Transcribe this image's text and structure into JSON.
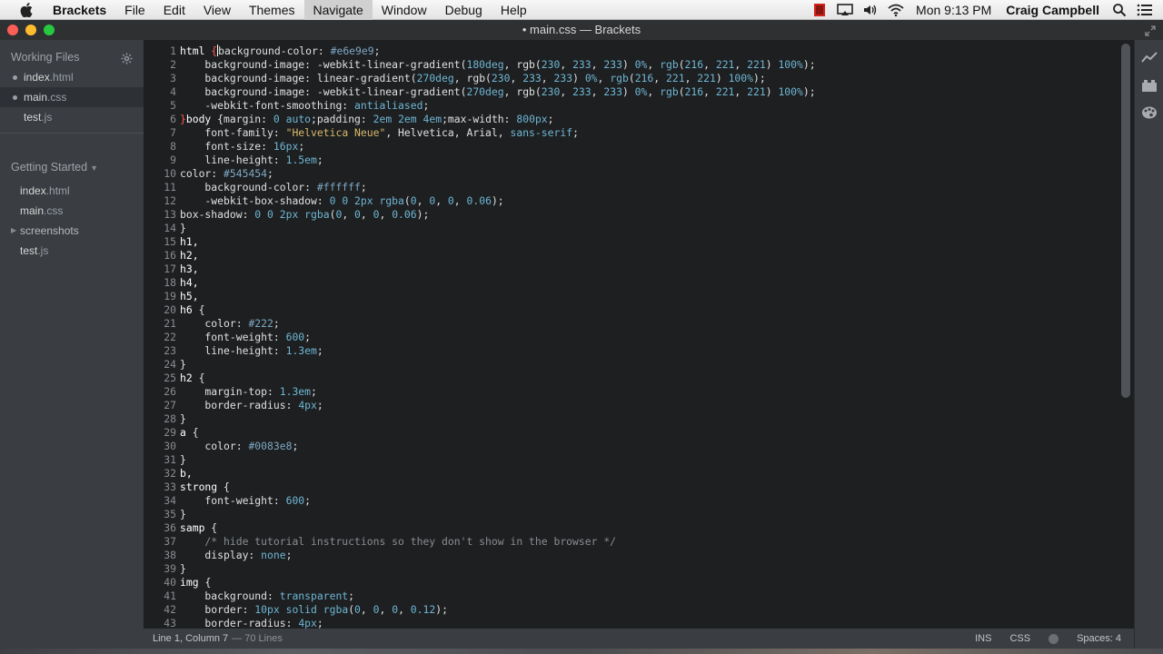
{
  "menubar": {
    "app_name": "Brackets",
    "items": [
      "File",
      "Edit",
      "View",
      "Themes",
      "Navigate",
      "Window",
      "Debug",
      "Help"
    ],
    "active_item": "Navigate",
    "clock": "Mon 9:13 PM",
    "user": "Craig Campbell"
  },
  "window": {
    "title": "• main.css — Brackets"
  },
  "sidebar": {
    "working_files_header": "Working Files",
    "working_files": [
      {
        "name": "index",
        "ext": ".html",
        "dirty": true
      },
      {
        "name": "main",
        "ext": ".css",
        "dirty": true,
        "selected": true
      },
      {
        "name": "test",
        "ext": ".js",
        "dirty": false
      }
    ],
    "project_header": "Getting Started",
    "project_files": [
      {
        "name": "index",
        "ext": ".html"
      },
      {
        "name": "main",
        "ext": ".css"
      },
      {
        "name": "screenshots",
        "ext": ""
      },
      {
        "name": "test",
        "ext": ".js"
      }
    ]
  },
  "editor": {
    "lines": [
      [
        [
          "sel",
          "html "
        ],
        [
          "err",
          "{"
        ],
        [
          "cursor",
          ""
        ],
        [
          "prop",
          "background-color: "
        ],
        [
          "hex",
          "#e6e9e9"
        ],
        [
          "prop",
          ";"
        ]
      ],
      [
        [
          "prop",
          "    background-image: -webkit-linear-gradient("
        ],
        [
          "num",
          "180deg"
        ],
        [
          "prop",
          ", rgb("
        ],
        [
          "num",
          "230"
        ],
        [
          "prop",
          ", "
        ],
        [
          "num",
          "233"
        ],
        [
          "prop",
          ", "
        ],
        [
          "num",
          "233"
        ],
        [
          "prop",
          ") "
        ],
        [
          "num",
          "0%"
        ],
        [
          "prop",
          ", "
        ],
        [
          "kw",
          "rgb"
        ],
        [
          "prop",
          "("
        ],
        [
          "num",
          "216"
        ],
        [
          "prop",
          ", "
        ],
        [
          "num",
          "221"
        ],
        [
          "prop",
          ", "
        ],
        [
          "num",
          "221"
        ],
        [
          "prop",
          ") "
        ],
        [
          "num",
          "100%"
        ],
        [
          "prop",
          ");"
        ]
      ],
      [
        [
          "prop",
          "    background-image: linear-gradient("
        ],
        [
          "num",
          "270deg"
        ],
        [
          "prop",
          ", rgb("
        ],
        [
          "num",
          "230"
        ],
        [
          "prop",
          ", "
        ],
        [
          "num",
          "233"
        ],
        [
          "prop",
          ", "
        ],
        [
          "num",
          "233"
        ],
        [
          "prop",
          ") "
        ],
        [
          "num",
          "0%"
        ],
        [
          "prop",
          ", "
        ],
        [
          "kw",
          "rgb"
        ],
        [
          "prop",
          "("
        ],
        [
          "num",
          "216"
        ],
        [
          "prop",
          ", "
        ],
        [
          "num",
          "221"
        ],
        [
          "prop",
          ", "
        ],
        [
          "num",
          "221"
        ],
        [
          "prop",
          ") "
        ],
        [
          "num",
          "100%"
        ],
        [
          "prop",
          ");"
        ]
      ],
      [
        [
          "prop",
          "    background-image: -webkit-linear-gradient("
        ],
        [
          "num",
          "270deg"
        ],
        [
          "prop",
          ", rgb("
        ],
        [
          "num",
          "230"
        ],
        [
          "prop",
          ", "
        ],
        [
          "num",
          "233"
        ],
        [
          "prop",
          ", "
        ],
        [
          "num",
          "233"
        ],
        [
          "prop",
          ") "
        ],
        [
          "num",
          "0%"
        ],
        [
          "prop",
          ", "
        ],
        [
          "kw",
          "rgb"
        ],
        [
          "prop",
          "("
        ],
        [
          "num",
          "216"
        ],
        [
          "prop",
          ", "
        ],
        [
          "num",
          "221"
        ],
        [
          "prop",
          ", "
        ],
        [
          "num",
          "221"
        ],
        [
          "prop",
          ") "
        ],
        [
          "num",
          "100%"
        ],
        [
          "prop",
          ");"
        ]
      ],
      [
        [
          "prop",
          "    -webkit-font-smoothing: "
        ],
        [
          "kw",
          "antialiased"
        ],
        [
          "prop",
          ";"
        ]
      ],
      [
        [
          "err",
          "}"
        ],
        [
          "sel",
          "body "
        ],
        [
          "prop",
          "{margin: "
        ],
        [
          "num",
          "0"
        ],
        [
          "prop",
          " "
        ],
        [
          "kw",
          "auto"
        ],
        [
          "prop",
          ";padding: "
        ],
        [
          "num",
          "2em"
        ],
        [
          "prop",
          " "
        ],
        [
          "num",
          "2em"
        ],
        [
          "prop",
          " "
        ],
        [
          "num",
          "4em"
        ],
        [
          "prop",
          ";max-width: "
        ],
        [
          "num",
          "800px"
        ],
        [
          "prop",
          ";"
        ]
      ],
      [
        [
          "prop",
          "    font-family: "
        ],
        [
          "str",
          "\"Helvetica Neue\""
        ],
        [
          "prop",
          ", Helvetica, Arial, "
        ],
        [
          "kw",
          "sans-serif"
        ],
        [
          "prop",
          ";"
        ]
      ],
      [
        [
          "prop",
          "    font-size: "
        ],
        [
          "num",
          "16px"
        ],
        [
          "prop",
          ";"
        ]
      ],
      [
        [
          "prop",
          "    line-height: "
        ],
        [
          "num",
          "1.5em"
        ],
        [
          "prop",
          ";"
        ]
      ],
      [
        [
          "prop",
          "color: "
        ],
        [
          "hex",
          "#545454"
        ],
        [
          "prop",
          ";"
        ]
      ],
      [
        [
          "prop",
          "    background-color: "
        ],
        [
          "hex",
          "#ffffff"
        ],
        [
          "prop",
          ";"
        ]
      ],
      [
        [
          "prop",
          "    -webkit-box-shadow: "
        ],
        [
          "num",
          "0"
        ],
        [
          "prop",
          " "
        ],
        [
          "num",
          "0"
        ],
        [
          "prop",
          " "
        ],
        [
          "num",
          "2px"
        ],
        [
          "prop",
          " "
        ],
        [
          "kw",
          "rgba"
        ],
        [
          "prop",
          "("
        ],
        [
          "num",
          "0"
        ],
        [
          "prop",
          ", "
        ],
        [
          "num",
          "0"
        ],
        [
          "prop",
          ", "
        ],
        [
          "num",
          "0"
        ],
        [
          "prop",
          ", "
        ],
        [
          "num",
          "0.06"
        ],
        [
          "prop",
          ");"
        ]
      ],
      [
        [
          "prop",
          "box-shadow: "
        ],
        [
          "num",
          "0"
        ],
        [
          "prop",
          " "
        ],
        [
          "num",
          "0"
        ],
        [
          "prop",
          " "
        ],
        [
          "num",
          "2px"
        ],
        [
          "prop",
          " "
        ],
        [
          "kw",
          "rgba"
        ],
        [
          "prop",
          "("
        ],
        [
          "num",
          "0"
        ],
        [
          "prop",
          ", "
        ],
        [
          "num",
          "0"
        ],
        [
          "prop",
          ", "
        ],
        [
          "num",
          "0"
        ],
        [
          "prop",
          ", "
        ],
        [
          "num",
          "0.06"
        ],
        [
          "prop",
          ");"
        ]
      ],
      [
        [
          "prop",
          "}"
        ]
      ],
      [
        [
          "sel",
          "h1,"
        ]
      ],
      [
        [
          "sel",
          "h2,"
        ]
      ],
      [
        [
          "sel",
          "h3,"
        ]
      ],
      [
        [
          "sel",
          "h4,"
        ]
      ],
      [
        [
          "sel",
          "h5,"
        ]
      ],
      [
        [
          "sel",
          "h6 "
        ],
        [
          "prop",
          "{"
        ]
      ],
      [
        [
          "prop",
          "    color: "
        ],
        [
          "hex",
          "#222"
        ],
        [
          "prop",
          ";"
        ]
      ],
      [
        [
          "prop",
          "    font-weight: "
        ],
        [
          "num",
          "600"
        ],
        [
          "prop",
          ";"
        ]
      ],
      [
        [
          "prop",
          "    line-height: "
        ],
        [
          "num",
          "1.3em"
        ],
        [
          "prop",
          ";"
        ]
      ],
      [
        [
          "prop",
          "}"
        ]
      ],
      [
        [
          "sel",
          "h2 "
        ],
        [
          "prop",
          "{"
        ]
      ],
      [
        [
          "prop",
          "    margin-top: "
        ],
        [
          "num",
          "1.3em"
        ],
        [
          "prop",
          ";"
        ]
      ],
      [
        [
          "prop",
          "    border-radius: "
        ],
        [
          "num",
          "4px"
        ],
        [
          "prop",
          ";"
        ]
      ],
      [
        [
          "prop",
          "}"
        ]
      ],
      [
        [
          "sel",
          "a "
        ],
        [
          "prop",
          "{"
        ]
      ],
      [
        [
          "prop",
          "    color: "
        ],
        [
          "hex",
          "#0083e8"
        ],
        [
          "prop",
          ";"
        ]
      ],
      [
        [
          "prop",
          "}"
        ]
      ],
      [
        [
          "sel",
          "b,"
        ]
      ],
      [
        [
          "sel",
          "strong "
        ],
        [
          "prop",
          "{"
        ]
      ],
      [
        [
          "prop",
          "    font-weight: "
        ],
        [
          "num",
          "600"
        ],
        [
          "prop",
          ";"
        ]
      ],
      [
        [
          "prop",
          "}"
        ]
      ],
      [
        [
          "sel",
          "samp "
        ],
        [
          "prop",
          "{"
        ]
      ],
      [
        [
          "com",
          "    /* hide tutorial instructions so they don't show in the browser */"
        ]
      ],
      [
        [
          "prop",
          "    display: "
        ],
        [
          "kw",
          "none"
        ],
        [
          "prop",
          ";"
        ]
      ],
      [
        [
          "prop",
          "}"
        ]
      ],
      [
        [
          "sel",
          "img "
        ],
        [
          "prop",
          "{"
        ]
      ],
      [
        [
          "prop",
          "    background: "
        ],
        [
          "kw",
          "transparent"
        ],
        [
          "prop",
          ";"
        ]
      ],
      [
        [
          "prop",
          "    border: "
        ],
        [
          "num",
          "10px"
        ],
        [
          "prop",
          " "
        ],
        [
          "kw",
          "solid"
        ],
        [
          "prop",
          " "
        ],
        [
          "kw",
          "rgba"
        ],
        [
          "prop",
          "("
        ],
        [
          "num",
          "0"
        ],
        [
          "prop",
          ", "
        ],
        [
          "num",
          "0"
        ],
        [
          "prop",
          ", "
        ],
        [
          "num",
          "0"
        ],
        [
          "prop",
          ", "
        ],
        [
          "num",
          "0.12"
        ],
        [
          "prop",
          ");"
        ]
      ],
      [
        [
          "prop",
          "    border-radius: "
        ],
        [
          "num",
          "4px"
        ],
        [
          "prop",
          ";"
        ]
      ]
    ]
  },
  "status": {
    "cursor_position": "Line 1, Column 7",
    "line_count": "— 70 Lines",
    "mode": "INS",
    "language": "CSS",
    "indent": "Spaces: 4"
  },
  "colors": {
    "editor_bg": "#1d1f21",
    "sidebar_bg": "#3a3d42",
    "number": "#6fb6d3",
    "string": "#d9b86a",
    "error": "#ff5a4a"
  }
}
